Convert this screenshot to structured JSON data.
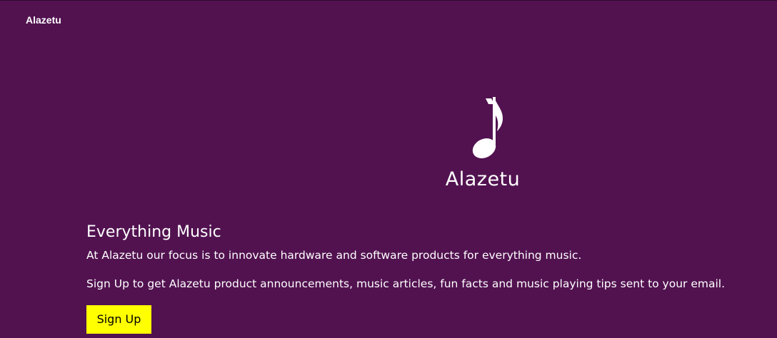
{
  "nav": {
    "brand": "Alazetu"
  },
  "hero": {
    "logo_icon": "music-note-icon",
    "logo_text": "Alazetu"
  },
  "main": {
    "headline": "Everything Music",
    "paragraph_1": "At Alazetu our focus is to innovate hardware and software products for everything music.",
    "paragraph_2": "Sign Up to get Alazetu product announcements, music articles, fun facts and music playing tips sent to your email.",
    "signup_label": "Sign Up"
  },
  "colors": {
    "background": "#521250",
    "button": "#ffff00",
    "text": "#ffffff"
  }
}
